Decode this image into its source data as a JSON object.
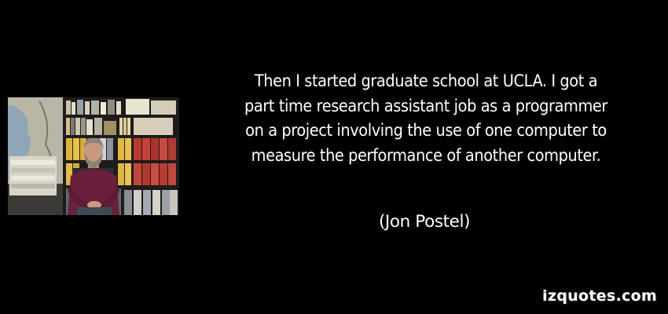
{
  "quote": {
    "lines": [
      "Then I started graduate school at UCLA. I got a",
      "part time research assistant job as a programmer",
      "on a project involving the use of one computer to",
      "measure the performance of another computer."
    ],
    "author": "(Jon Postel)"
  },
  "watermark": {
    "text": "izquotes.com"
  },
  "colors": {
    "background": "#000000",
    "text": "#ffffff"
  },
  "photo": {
    "icon": "portrait-photo"
  }
}
